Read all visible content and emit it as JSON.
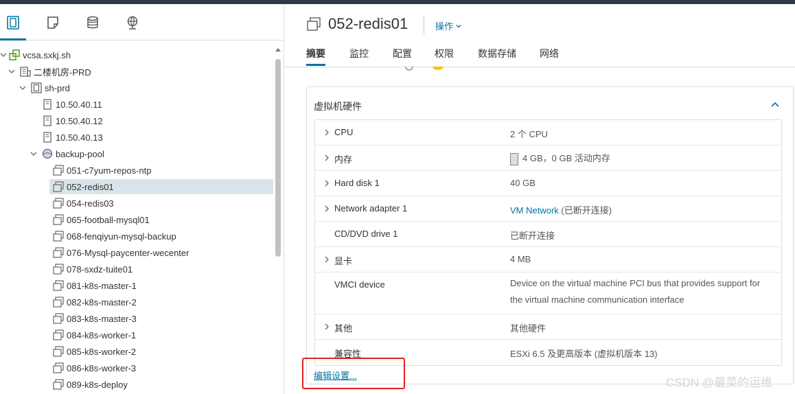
{
  "left_tabs": [
    {
      "icon": "hosts-clusters-icon",
      "active": true
    },
    {
      "icon": "vms-templates-icon",
      "active": false
    },
    {
      "icon": "storage-icon",
      "active": false
    },
    {
      "icon": "networking-icon",
      "active": false
    }
  ],
  "tree": [
    {
      "label": "vcsa.sxkj.sh",
      "icon": "vcenter-icon",
      "expanded": true
    },
    {
      "label": "二楼机房-PRD",
      "icon": "datacenter-icon",
      "expanded": true
    },
    {
      "label": "sh-prd",
      "icon": "cluster-icon",
      "expanded": true
    },
    {
      "label": "10.50.40.11",
      "icon": "host-icon"
    },
    {
      "label": "10.50.40.12",
      "icon": "host-icon"
    },
    {
      "label": "10.50.40.13",
      "icon": "host-icon"
    },
    {
      "label": "backup-pool",
      "icon": "resource-pool-icon",
      "expanded": true
    },
    {
      "label": "051-c7yum-repos-ntp",
      "icon": "vm-icon"
    },
    {
      "label": "052-redis01",
      "icon": "vm-icon",
      "selected": true
    },
    {
      "label": "054-redis03",
      "icon": "vm-icon"
    },
    {
      "label": "065-football-mysql01",
      "icon": "vm-icon"
    },
    {
      "label": "068-fenqiyun-mysql-backup",
      "icon": "vm-icon"
    },
    {
      "label": "076-Mysql-paycenter-wecenter",
      "icon": "vm-icon"
    },
    {
      "label": "078-sxdz-tuite01",
      "icon": "vm-icon"
    },
    {
      "label": "081-k8s-master-1",
      "icon": "vm-icon"
    },
    {
      "label": "082-k8s-master-2",
      "icon": "vm-icon"
    },
    {
      "label": "083-k8s-master-3",
      "icon": "vm-icon"
    },
    {
      "label": "084-k8s-worker-1",
      "icon": "vm-icon"
    },
    {
      "label": "085-k8s-worker-2",
      "icon": "vm-icon"
    },
    {
      "label": "086-k8s-worker-3",
      "icon": "vm-icon"
    },
    {
      "label": "089-k8s-deploy",
      "icon": "vm-icon"
    }
  ],
  "header": {
    "vm_name": "052-redis01",
    "actions_label": "操作"
  },
  "tabs": [
    {
      "label": "摘要",
      "active": true
    },
    {
      "label": "监控"
    },
    {
      "label": "配置"
    },
    {
      "label": "权限"
    },
    {
      "label": "数据存储"
    },
    {
      "label": "网络"
    }
  ],
  "hardware": {
    "title": "虚拟机硬件",
    "rows": [
      {
        "name": "CPU",
        "value": "2 个 CPU",
        "expandable": true
      },
      {
        "name": "内存",
        "value": "4 GB，0 GB 活动内存",
        "expandable": true,
        "icon": "memory-icon"
      },
      {
        "name": "Hard disk 1",
        "value": "40 GB",
        "expandable": true
      },
      {
        "name": "Network adapter 1",
        "value_link": "VM Network",
        "value": " (已断开连接)",
        "expandable": true
      },
      {
        "name": "CD/DVD drive 1",
        "value": "已断开连接",
        "expandable": false
      },
      {
        "name": "显卡",
        "value": "4 MB",
        "expandable": true
      },
      {
        "name": "VMCI device",
        "value": "Device on the virtual machine PCI bus that provides support for the virtual machine communication interface",
        "expandable": false
      },
      {
        "name": "其他",
        "value": "其他硬件",
        "expandable": true
      },
      {
        "name": "兼容性",
        "value": "ESXi 6.5 及更高版本 (虚拟机版本 13)",
        "expandable": false
      }
    ],
    "edit_label": "编辑设置..."
  },
  "highlight_color": "#e02020",
  "accent_color": "#0072a3",
  "watermark": "CSDN @最菜的运维"
}
